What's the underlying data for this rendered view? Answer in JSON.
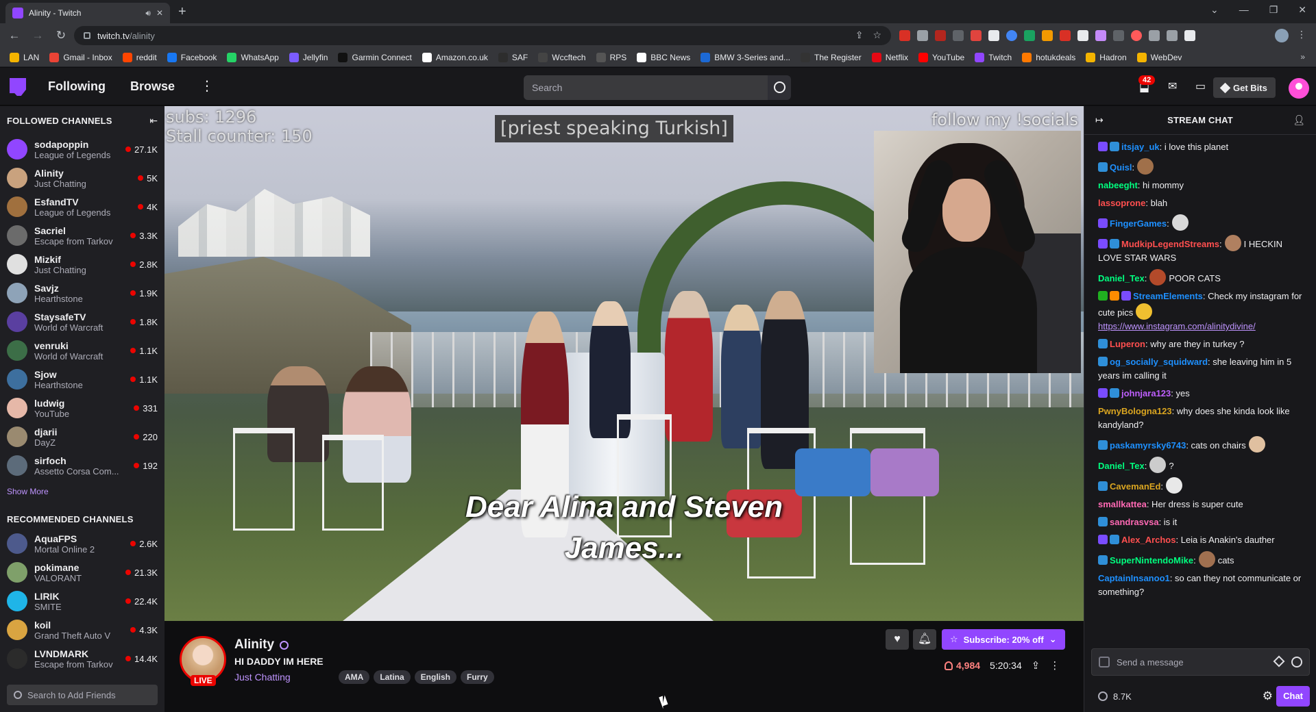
{
  "browser": {
    "tab_title": "Alinity - Twitch",
    "url_host": "twitch.tv",
    "url_path": "/alinity",
    "bookmarks": [
      {
        "label": "LAN",
        "color": "#f4b400"
      },
      {
        "label": "Gmail - Inbox",
        "color": "#ea4335"
      },
      {
        "label": "reddit",
        "color": "#ff4500"
      },
      {
        "label": "Facebook",
        "color": "#1877f2"
      },
      {
        "label": "WhatsApp",
        "color": "#25d366"
      },
      {
        "label": "Jellyfin",
        "color": "#7b5cff"
      },
      {
        "label": "Garmin Connect",
        "color": "#111111"
      },
      {
        "label": "Amazon.co.uk",
        "color": "#ffffff"
      },
      {
        "label": "SAF",
        "color": "#2d2d2d"
      },
      {
        "label": "Wccftech",
        "color": "#444444"
      },
      {
        "label": "RPS",
        "color": "#555555"
      },
      {
        "label": "BBC News",
        "color": "#ffffff"
      },
      {
        "label": "BMW 3-Series and...",
        "color": "#1c69d4"
      },
      {
        "label": "The Register",
        "color": "#333333"
      },
      {
        "label": "Netflix",
        "color": "#e50914"
      },
      {
        "label": "YouTube",
        "color": "#ff0000"
      },
      {
        "label": "Twitch",
        "color": "#9146ff"
      },
      {
        "label": "hotukdeals",
        "color": "#ff7900"
      },
      {
        "label": "Hadron",
        "color": "#f4b400"
      },
      {
        "label": "WebDev",
        "color": "#f4b400"
      }
    ],
    "bookmarks_more": "»"
  },
  "twitch_nav": {
    "following": "Following",
    "browse": "Browse",
    "search_placeholder": "Search",
    "notifications_count": "42",
    "get_bits": "Get Bits"
  },
  "sidebar": {
    "followed_header": "FOLLOWED CHANNELS",
    "followed": [
      {
        "name": "sodapoppin",
        "game": "League of Legends",
        "viewers": "27.1K",
        "color": "#9146ff"
      },
      {
        "name": "Alinity",
        "game": "Just Chatting",
        "viewers": "5K",
        "color": "#c9a27e"
      },
      {
        "name": "EsfandTV",
        "game": "League of Legends",
        "viewers": "4K",
        "color": "#a0703e"
      },
      {
        "name": "Sacriel",
        "game": "Escape from Tarkov",
        "viewers": "3.3K",
        "color": "#6b6b6b"
      },
      {
        "name": "Mizkif",
        "game": "Just Chatting",
        "viewers": "2.8K",
        "color": "#e0e0e0"
      },
      {
        "name": "Savjz",
        "game": "Hearthstone",
        "viewers": "1.9K",
        "color": "#8ea3b8"
      },
      {
        "name": "StaysafeTV",
        "game": "World of Warcraft",
        "viewers": "1.8K",
        "color": "#5a3fa0"
      },
      {
        "name": "venruki",
        "game": "World of Warcraft",
        "viewers": "1.1K",
        "color": "#3c6e47"
      },
      {
        "name": "Sjow",
        "game": "Hearthstone",
        "viewers": "1.1K",
        "color": "#3d6f9e"
      },
      {
        "name": "ludwig",
        "game": "YouTube",
        "viewers": "331",
        "color": "#e6b8a8"
      },
      {
        "name": "djarii",
        "game": "DayZ",
        "viewers": "220",
        "color": "#9a8a70"
      },
      {
        "name": "sirfoch",
        "game": "Assetto Corsa Com...",
        "viewers": "192",
        "color": "#5c6b7a"
      }
    ],
    "show_more": "Show More",
    "recommended_header": "RECOMMENDED CHANNELS",
    "recommended": [
      {
        "name": "AquaFPS",
        "game": "Mortal Online 2",
        "viewers": "2.6K",
        "color": "#4d5a8c"
      },
      {
        "name": "pokimane",
        "game": "VALORANT",
        "viewers": "21.3K",
        "color": "#7fa06a"
      },
      {
        "name": "LIRIK",
        "game": "SMITE",
        "viewers": "22.4K",
        "color": "#1fb5e8"
      },
      {
        "name": "koil",
        "game": "Grand Theft Auto V",
        "viewers": "4.3K",
        "color": "#d9a441"
      },
      {
        "name": "LVNDMARK",
        "game": "Escape from Tarkov",
        "viewers": "14.4K",
        "color": "#2b2b2b"
      }
    ],
    "friends_placeholder": "Search to Add Friends"
  },
  "video": {
    "overlay_subs": "subs: 1296",
    "overlay_stall": "Stall counter: 150",
    "overlay_caption": "[priest speaking Turkish]",
    "overlay_social": "follow my !socials",
    "subtitle_line1": "Dear Alina and Steven",
    "subtitle_line2": "James..."
  },
  "stream_info": {
    "streamer": "Alinity",
    "live": "LIVE",
    "title": "HI DADDY IM HERE",
    "category": "Just Chatting",
    "tags": [
      "AMA",
      "Latina",
      "English",
      "Furry"
    ],
    "subscribe": "Subscribe: 20% off",
    "viewers": "4,984",
    "uptime": "5:20:34"
  },
  "chat": {
    "header": "STREAM CHAT",
    "messages": [
      {
        "user": "itsjay_uk",
        "color": "#1e90ff",
        "badges": [
          "#7a4cff",
          "#2f8fd8"
        ],
        "text": ": i love this planet"
      },
      {
        "user": "Quisl",
        "color": "#1e90ff",
        "badges": [
          "#2f8fd8"
        ],
        "text": ":",
        "emote": "#a0704a"
      },
      {
        "user": "nabeeght",
        "color": "#00ff7f",
        "badges": [],
        "text": ": hi mommy"
      },
      {
        "user": "lassoprone",
        "color": "#ff4f4f",
        "badges": [],
        "text": ": blah"
      },
      {
        "user": "FingerGames",
        "color": "#1e90ff",
        "badges": [
          "#7a4cff"
        ],
        "text": ":",
        "emote": "#d9d9d9"
      },
      {
        "user": "MudkipLegendStreams",
        "color": "#ff4f4f",
        "badges": [
          "#7a4cff",
          "#2f8fd8"
        ],
        "text": ":",
        "emote": "#b08060",
        "after": "I HECKIN LOVE STAR WARS"
      },
      {
        "user": "Daniel_Tex",
        "color": "#00ff7f",
        "badges": [],
        "text": ":",
        "emote": "#b34a2a",
        "after": "POOR CATS"
      },
      {
        "user": "StreamElements",
        "color": "#1e90ff",
        "badges": [
          "#20b020",
          "#ff8c00",
          "#7a4cff"
        ],
        "text": ": Check my instagram for cute pics",
        "emote": "#f0c030",
        "link": "https://www.instagram.com/alinitydivine/"
      },
      {
        "user": "Luperon",
        "color": "#ff4f4f",
        "badges": [
          "#2f8fd8"
        ],
        "text": ": why are they in turkey ?"
      },
      {
        "user": "og_socially_squidward",
        "color": "#1e90ff",
        "badges": [
          "#2f8fd8"
        ],
        "text": ": she leaving him in 5 years im calling it"
      },
      {
        "user": "johnjara123",
        "color": "#bf5fff",
        "badges": [
          "#7a4cff",
          "#2f8fd8"
        ],
        "text": ": yes"
      },
      {
        "user": "PwnyBologna123",
        "color": "#daa520",
        "badges": [],
        "text": ": why does she kinda look like kandyland?"
      },
      {
        "user": "paskamyrsky6743",
        "color": "#1e90ff",
        "badges": [
          "#2f8fd8"
        ],
        "text": ": cats on chairs",
        "emote": "#e0c0a0"
      },
      {
        "user": "Daniel_Tex",
        "color": "#00ff7f",
        "badges": [],
        "text": ":",
        "emote": "#cccccc",
        "after": "?"
      },
      {
        "user": "CavemanEd",
        "color": "#daa520",
        "badges": [
          "#2f8fd8"
        ],
        "text": ":",
        "emote": "#e8e8e8"
      },
      {
        "user": "smallkattea",
        "color": "#ff69b4",
        "badges": [],
        "text": ": Her dress is super cute"
      },
      {
        "user": "sandrasvsa",
        "color": "#ff69b4",
        "badges": [
          "#2f8fd8"
        ],
        "text": ": is it"
      },
      {
        "user": "Alex_Archos",
        "color": "#ff4f4f",
        "badges": [
          "#7a4cff",
          "#2f8fd8"
        ],
        "text": ": Leia is Anakin's dauther"
      },
      {
        "user": "SuperNintendoMike",
        "color": "#00ff7f",
        "badges": [
          "#2f8fd8"
        ],
        "text": ":",
        "emote": "#a07050",
        "after": "cats"
      },
      {
        "user": "CaptainInsanoo1",
        "color": "#1e90ff",
        "badges": [],
        "text": ": so can they not communicate or something?"
      }
    ],
    "input_placeholder": "Send a message",
    "points": "8.7K",
    "chat_button": "Chat"
  }
}
